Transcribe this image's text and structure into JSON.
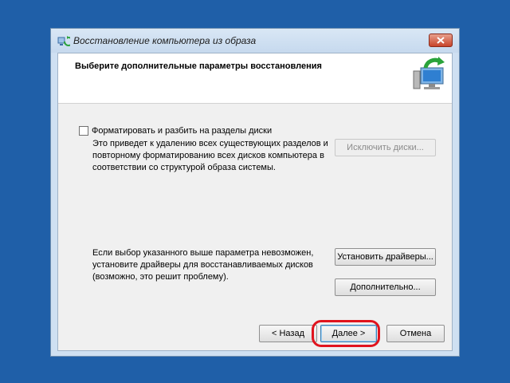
{
  "window": {
    "title": "Восстановление компьютера из образа",
    "close_icon": "close-icon"
  },
  "header": {
    "title": "Выберите дополнительные параметры восстановления",
    "icon": "restore-computer-icon"
  },
  "format_option": {
    "checked": false,
    "label": "Форматировать и разбить на разделы диски",
    "description": "Это приведет к удалению всех существующих разделов и повторному форматированию всех дисков компьютера в соответствии со структурой образа системы.",
    "exclude_button": "Исключить диски..."
  },
  "drivers": {
    "note": "Если выбор указанного выше параметра невозможен, установите драйверы для восстанавливаемых дисков (возможно, это решит проблему).",
    "install_button": "Установить драйверы...",
    "advanced_button": "Дополнительно..."
  },
  "footer": {
    "back_button": "< Назад",
    "next_button": "Далее >",
    "cancel_button": "Отмена"
  },
  "colors": {
    "desktop": "#1f5fa8",
    "highlight": "#e0141e",
    "close": "#c8442a"
  }
}
